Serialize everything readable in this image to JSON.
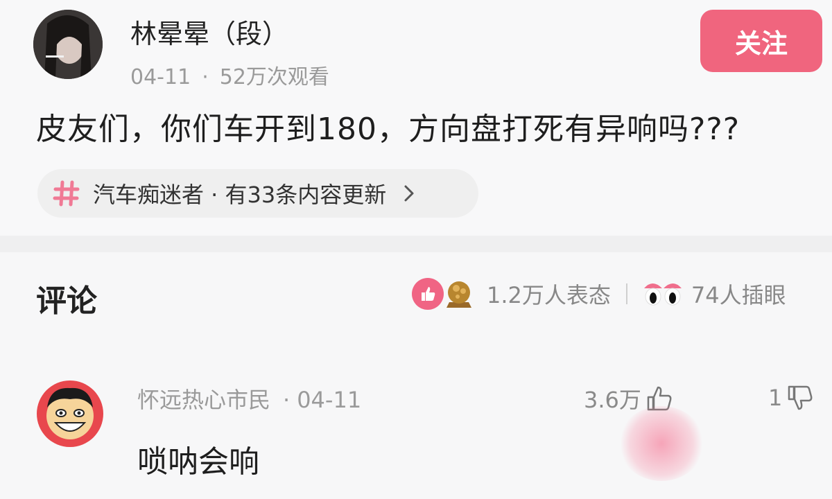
{
  "post": {
    "author": "林晕晕（段）",
    "date": "04-11",
    "dot": "·",
    "views": "52万次观看",
    "follow_label": "关注",
    "text": "皮友们，你们车开到180，方向盘打死有异响吗???",
    "topic": "汽车痴迷者 · 有33条内容更新"
  },
  "comments_section": {
    "title": "评论",
    "reactions": "1.2万人表态",
    "stares": "74人插眼"
  },
  "comment": {
    "user": "怀远热心市民",
    "dot": "·",
    "date": "04-11",
    "likes": "3.6万",
    "dislikes": "1",
    "text": "唢呐会响"
  },
  "colors": {
    "accent": "#f0657e",
    "background": "#f7f7f8",
    "muted_text": "#9a9a9a"
  },
  "icons": {
    "topic": "hash-icon",
    "more": "chevron-right-icon",
    "like": "thumb-up-icon",
    "dislike": "thumb-down-icon",
    "stare": "eyes-icon"
  }
}
